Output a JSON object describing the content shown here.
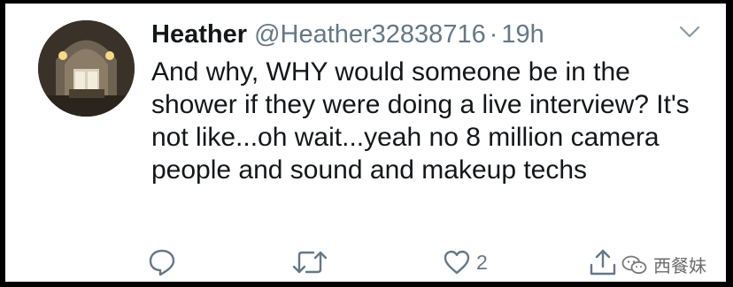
{
  "tweet": {
    "display_name": "Heather",
    "handle": "@Heather32838716",
    "separator": "·",
    "time": "19h",
    "text": "And why, WHY would someone be in the shower if they were doing a live interview? It's not like...oh wait...yeah no 8 million camera people and sound and makeup techs"
  },
  "actions": {
    "reply_icon": "reply-icon",
    "retweet_icon": "retweet-icon",
    "like_icon": "heart-icon",
    "like_count": "2",
    "share_icon": "share-icon"
  },
  "watermark": {
    "text": "西餐妹",
    "icon": "wechat-icon"
  },
  "colors": {
    "text": "#14171a",
    "secondary": "#657786",
    "background": "#ffffff"
  }
}
